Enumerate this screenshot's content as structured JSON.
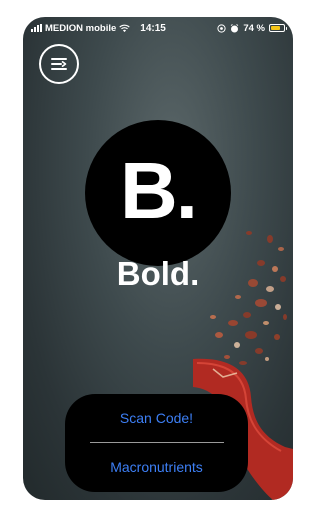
{
  "status_bar": {
    "carrier": "MEDION mobile",
    "time": "14:15",
    "battery_text": "74 %",
    "battery_level": 0.74,
    "battery_color": "#f5c518",
    "icons": [
      "signal-icon",
      "wifi-icon",
      "location-icon",
      "alarm-icon",
      "battery-icon"
    ]
  },
  "menu": {
    "icon": "menu-icon"
  },
  "logo": {
    "text": "B."
  },
  "brand": {
    "name": "Bold."
  },
  "actions": {
    "scan_label": "Scan Code!",
    "macros_label": "Macronutrients"
  },
  "colors": {
    "accent": "#3d7ff5",
    "sheet_bg": "#000000",
    "text": "#ffffff"
  }
}
